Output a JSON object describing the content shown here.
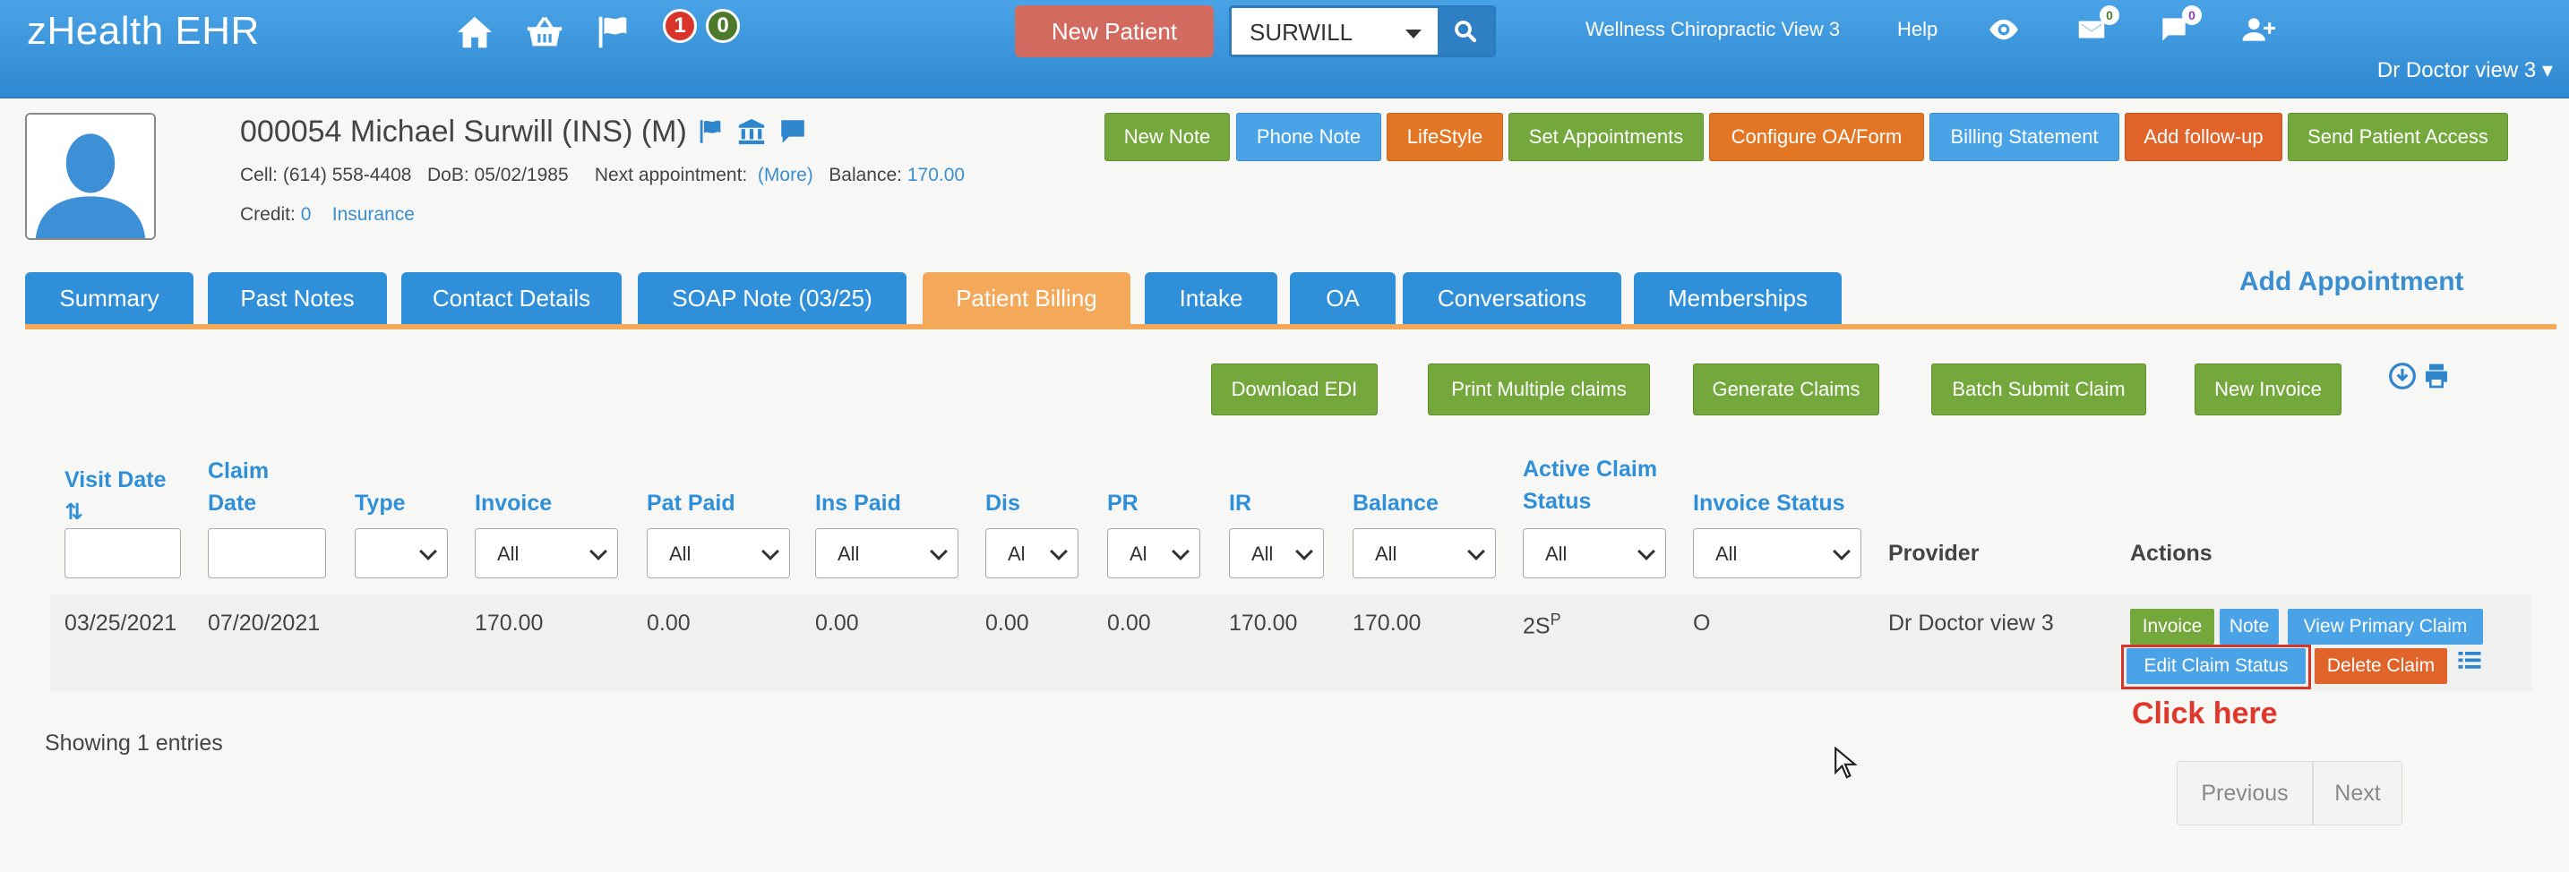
{
  "topbar": {
    "brand": "zHealth EHR",
    "notif_red": "1",
    "notif_green": "0",
    "new_patient": "New Patient",
    "search_value": "SURWILL",
    "clinic": "Wellness Chiropractic View 3",
    "help": "Help",
    "mail_badge": "0",
    "chat_badge": "0",
    "user": "Dr Doctor view 3 ▾"
  },
  "patient": {
    "name": "000054 Michael Surwill  (INS) (M)",
    "cell_label": "Cell:",
    "cell": "(614) 558-4408",
    "dob_label": "DoB:",
    "dob": "05/02/1985",
    "next_label": "Next appointment:",
    "next_more": "(More)",
    "balance_label": "Balance:",
    "balance": "170.00",
    "credit_label": "Credit:",
    "credit": "0",
    "insurance": "Insurance"
  },
  "action_buttons": [
    "New Note",
    "Phone Note",
    "LifeStyle",
    "Set Appointments",
    "Configure OA/Form",
    "Billing Statement",
    "Add follow-up",
    "Send Patient Access"
  ],
  "tabs": [
    "Summary",
    "Past Notes",
    "Contact Details",
    "SOAP Note (03/25)",
    "Patient Billing",
    "Intake",
    "OA",
    "Conversations",
    "Memberships"
  ],
  "add_appointment": "Add Appointment",
  "toolbar": [
    "Download EDI",
    "Print Multiple claims",
    "Generate Claims",
    "Batch Submit Claim",
    "New Invoice"
  ],
  "table": {
    "headers": {
      "visit_date": "Visit Date",
      "sort": "⇅",
      "claim_date_1": "Claim",
      "claim_date_2": "Date",
      "type": "Type",
      "invoice": "Invoice",
      "pat_paid": "Pat Paid",
      "ins_paid": "Ins Paid",
      "dis": "Dis",
      "pr": "PR",
      "ir": "IR",
      "balance": "Balance",
      "active_claim_1": "Active Claim",
      "active_claim_2": "Status",
      "invoice_status": "Invoice Status",
      "provider": "Provider",
      "actions": "Actions"
    },
    "filter_all": "All",
    "filter_all_short": "Al",
    "row": {
      "visit_date": "03/25/2021",
      "claim_date": "07/20/2021",
      "invoice": "170.00",
      "pat_paid": "0.00",
      "ins_paid": "0.00",
      "dis": "0.00",
      "pr": "0.00",
      "ir": "170.00",
      "balance": "170.00",
      "claim_status": "2S",
      "claim_status_sup": "P",
      "invoice_status": "O",
      "provider": "Dr Doctor view 3"
    },
    "row_buttons": {
      "invoice": "Invoice",
      "note": "Note",
      "view_primary": "View Primary Claim",
      "edit_status": "Edit Claim Status",
      "delete": "Delete Claim"
    }
  },
  "callout": "Click here",
  "showing": "Showing 1 entries",
  "pager": {
    "previous": "Previous",
    "next": "Next"
  }
}
